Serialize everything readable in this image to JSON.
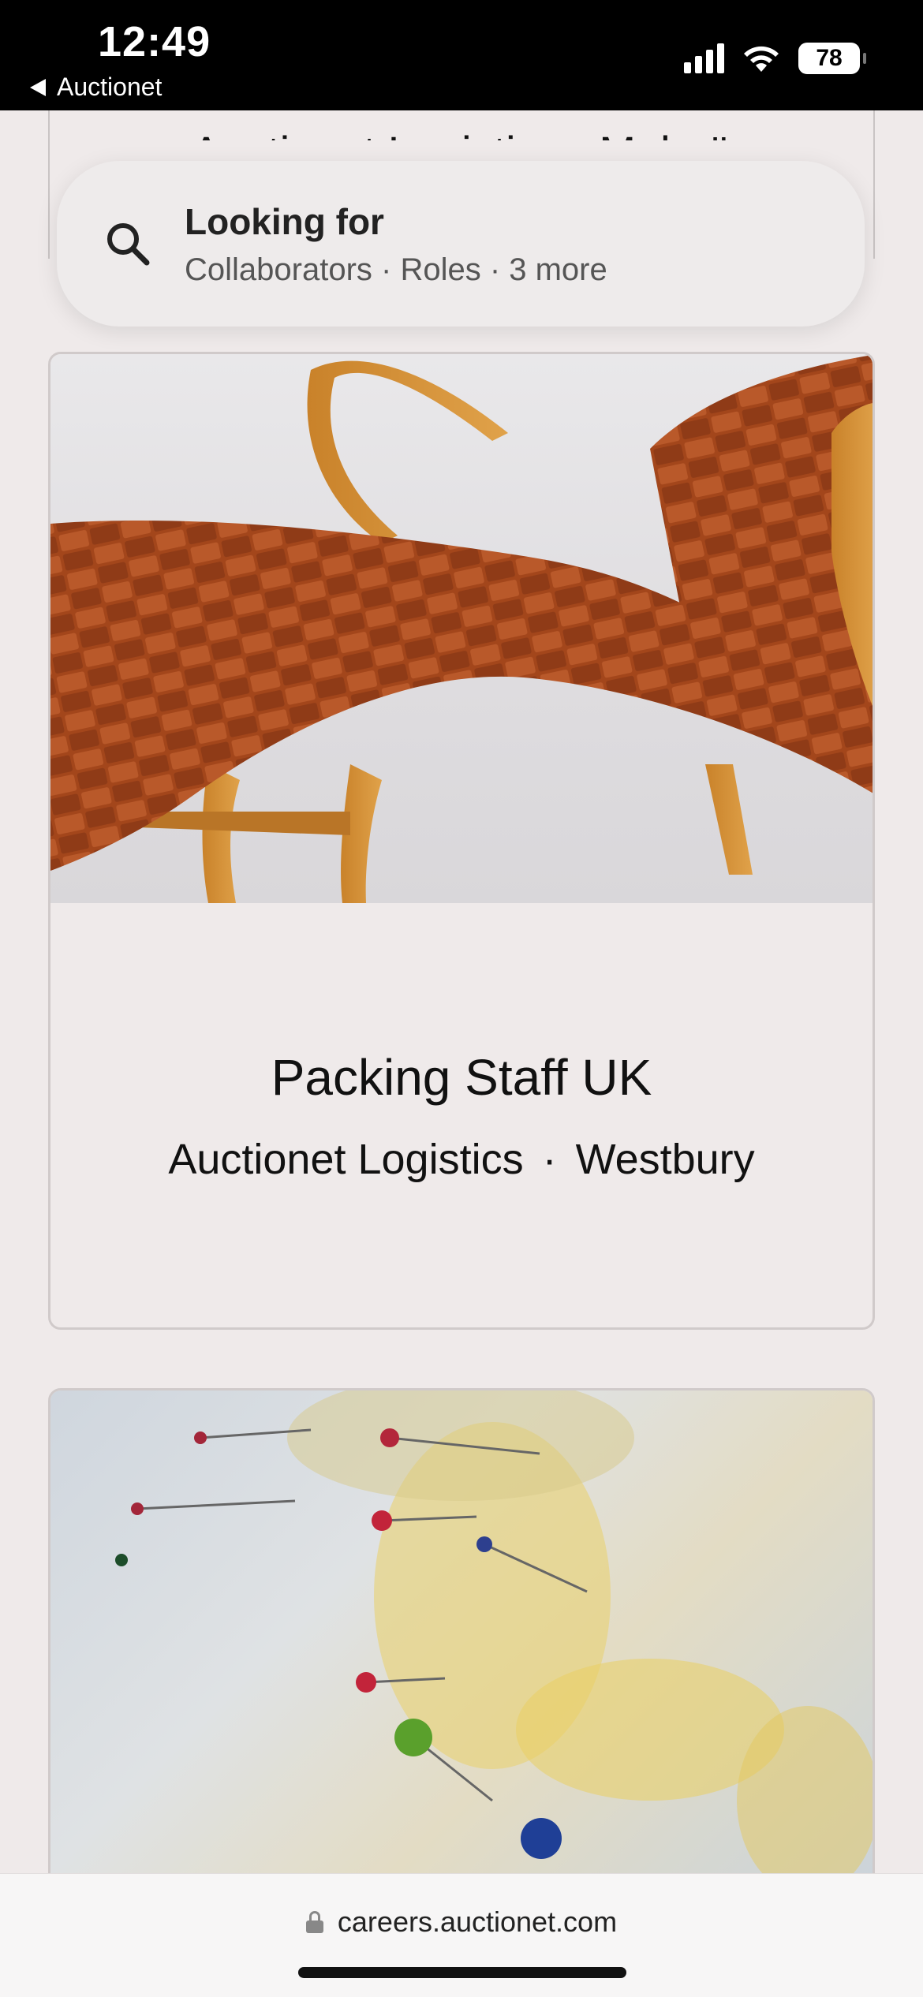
{
  "status_bar": {
    "time": "12:49",
    "back_app": "Auctionet",
    "battery": "78"
  },
  "previous_card": {
    "subtitle": "Auctionet Logistics · Malmö"
  },
  "search": {
    "title": "Looking for",
    "subtitle": "Collaborators · Roles · 3 more"
  },
  "jobs": [
    {
      "title": "Packing Staff UK",
      "company": "Auctionet Logistics",
      "separator": "·",
      "location": "Westbury",
      "image": "leather-lounge-chair-photo"
    },
    {
      "image": "world-map-with-pins-photo"
    }
  ],
  "browser": {
    "url": "careers.auctionet.com"
  }
}
